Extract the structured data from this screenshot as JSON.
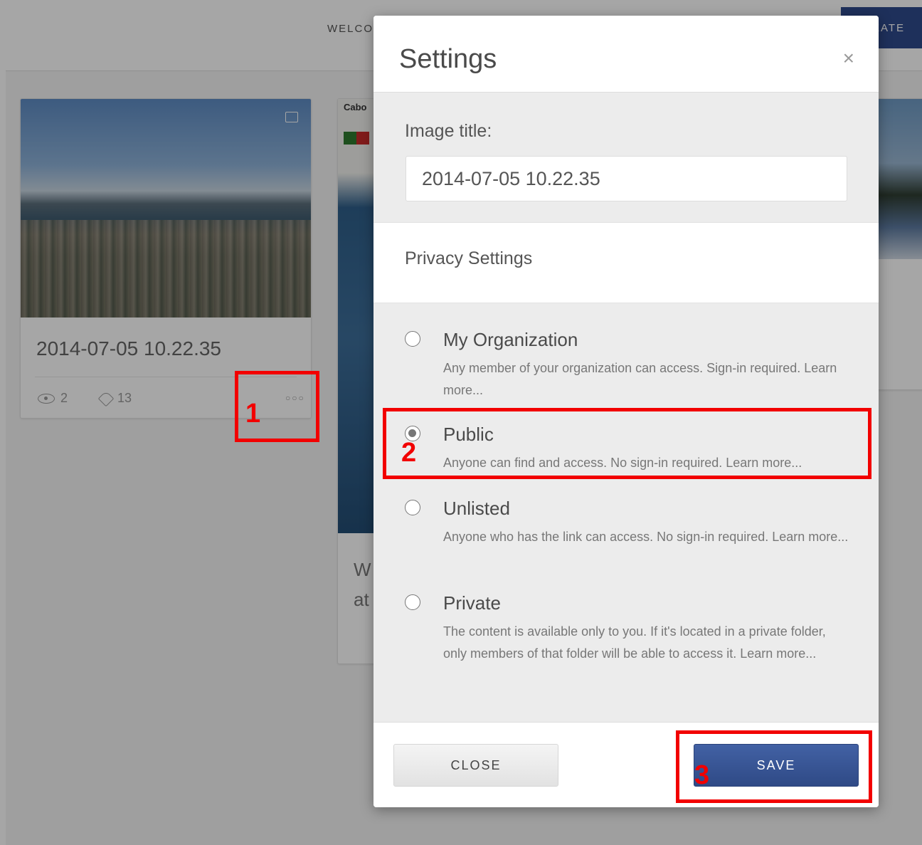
{
  "topbar": {
    "welcome_text": "WELCO",
    "create_label": "EATE"
  },
  "cards": {
    "card1": {
      "title": "2014-07-05 10.22.35",
      "views": "2",
      "tags": "13",
      "more": "○○○"
    },
    "card2": {
      "label": "Cabo",
      "text_line1": "W",
      "text_line2": "at"
    }
  },
  "modal": {
    "title": "Settings",
    "close_symbol": "×",
    "image_title_label": "Image title:",
    "image_title_value": "2014-07-05 10.22.35",
    "privacy_heading": "Privacy Settings",
    "options": [
      {
        "label": "My Organization",
        "description": "Any member of your organization can access. Sign-in required. Learn more...",
        "selected": false
      },
      {
        "label": "Public",
        "description": "Anyone can find and access. No sign-in required. Learn more...",
        "selected": true
      },
      {
        "label": "Unlisted",
        "description": "Anyone who has the link can access. No sign-in required. Learn more...",
        "selected": false
      },
      {
        "label": "Private",
        "description": "The content is available only to you. If it's located in a private folder, only members of that folder will be able to access it. Learn more...",
        "selected": false
      }
    ],
    "close_button": "CLOSE",
    "save_button": "SAVE"
  },
  "annotations": {
    "step1": "1",
    "step2": "2",
    "step3": "3"
  },
  "colors": {
    "primary": "#2f4a86",
    "annotation": "#f20000"
  }
}
